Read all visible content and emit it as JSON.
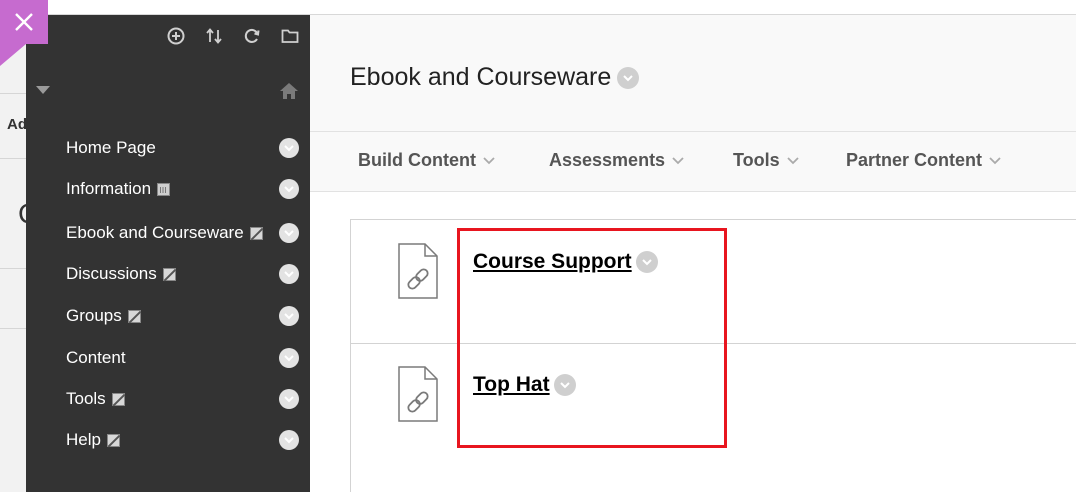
{
  "background_fragments": {
    "left_text": "Ad",
    "left_big": "C"
  },
  "sidebar": {
    "items": [
      {
        "label": "Home Page",
        "mark": ""
      },
      {
        "label": "Information",
        "mark": "calendar"
      },
      {
        "label": "Ebook and Courseware",
        "mark": "hidden"
      },
      {
        "label": "Discussions",
        "mark": "hidden"
      },
      {
        "label": "Groups",
        "mark": "hidden"
      },
      {
        "label": "Content",
        "mark": ""
      },
      {
        "label": "Tools",
        "mark": "hidden"
      },
      {
        "label": "Help",
        "mark": "hidden"
      }
    ],
    "tools": [
      "add-circle-icon",
      "sort-arrows-icon",
      "refresh-icon",
      "folder-icon"
    ]
  },
  "main": {
    "title": "Ebook and Courseware",
    "actions": [
      {
        "label": "Build Content"
      },
      {
        "label": "Assessments"
      },
      {
        "label": "Tools"
      },
      {
        "label": "Partner Content"
      }
    ],
    "content_items": [
      {
        "title": "Course Support",
        "icon": "web-link-icon"
      },
      {
        "title": "Top Hat",
        "icon": "web-link-icon"
      }
    ]
  },
  "colors": {
    "accent_purple": "#c66bcf",
    "sidebar_bg": "#333333",
    "highlight_red": "#e8151f"
  }
}
